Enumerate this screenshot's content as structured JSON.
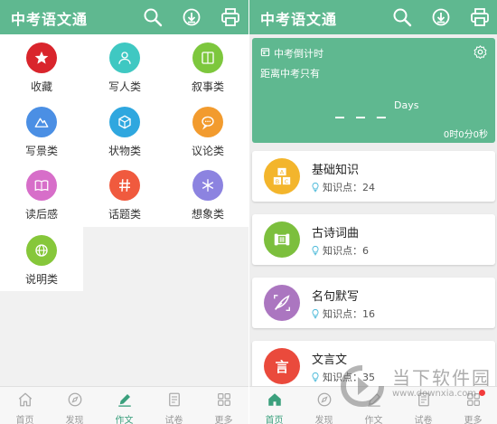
{
  "left": {
    "appbar": {
      "title": "中考语文通"
    },
    "categories": [
      {
        "label": "收藏",
        "icon": "star-icon",
        "color": "#d9252c"
      },
      {
        "label": "写人类",
        "icon": "person-icon",
        "color": "#3fc8c2"
      },
      {
        "label": "叙事类",
        "icon": "book-icon",
        "color": "#7dc73d"
      },
      {
        "label": "写景类",
        "icon": "landscape-icon",
        "color": "#4b8fe4"
      },
      {
        "label": "状物类",
        "icon": "cube-icon",
        "color": "#2fa7df"
      },
      {
        "label": "议论类",
        "icon": "chat-bubble-icon",
        "color": "#f29b2e"
      },
      {
        "label": "读后感",
        "icon": "open-book-icon",
        "color": "#d76ec9"
      },
      {
        "label": "话题类",
        "icon": "hashtag-icon",
        "color": "#f05a3e"
      },
      {
        "label": "想象类",
        "icon": "snowflake-icon",
        "color": "#8c83e0"
      },
      {
        "label": "说明类",
        "icon": "globe-icon",
        "color": "#86c73a"
      }
    ],
    "tabs": [
      {
        "label": "首页",
        "icon": "home-icon"
      },
      {
        "label": "发现",
        "icon": "compass-icon"
      },
      {
        "label": "作文",
        "icon": "pencil-icon",
        "active": true
      },
      {
        "label": "试卷",
        "icon": "test-paper-icon"
      },
      {
        "label": "更多",
        "icon": "grid-icon"
      }
    ]
  },
  "right": {
    "appbar": {
      "title": "中考语文通"
    },
    "countdown": {
      "title": "中考倒计时",
      "subtitle": "距离中考只有",
      "dashes": "_ _ _",
      "unit": "Days",
      "time": "0时0分0秒"
    },
    "cards": [
      {
        "title": "基础知识",
        "meta_label": "知识点：",
        "count": "24",
        "color": "#f3b52c",
        "icon": "abc-blocks-icon"
      },
      {
        "title": "古诗词曲",
        "meta_label": "知识点：",
        "count": "6",
        "color": "#7cbf3d",
        "icon": "scroll-icon"
      },
      {
        "title": "名句默写",
        "meta_label": "知识点：",
        "count": "16",
        "color": "#ab76c0",
        "icon": "quill-icon"
      },
      {
        "title": "文言文",
        "meta_label": "知识点：",
        "count": "35",
        "color": "#ea4a3c",
        "icon": "classical-text-icon",
        "icon_char": "言"
      }
    ],
    "tabs": [
      {
        "label": "首页",
        "icon": "home-icon",
        "active": true
      },
      {
        "label": "发现",
        "icon": "compass-icon"
      },
      {
        "label": "作文",
        "icon": "pencil-icon"
      },
      {
        "label": "试卷",
        "icon": "test-paper-icon"
      },
      {
        "label": "更多",
        "icon": "grid-icon",
        "badge": true
      }
    ]
  },
  "watermark": {
    "text": "当下软件园",
    "url": "www.downxia.com"
  },
  "colors": {
    "primary": "#5fb890",
    "tab_active": "#3ba07d",
    "tab_inactive": "#999999",
    "badge": "#f23b3b"
  }
}
